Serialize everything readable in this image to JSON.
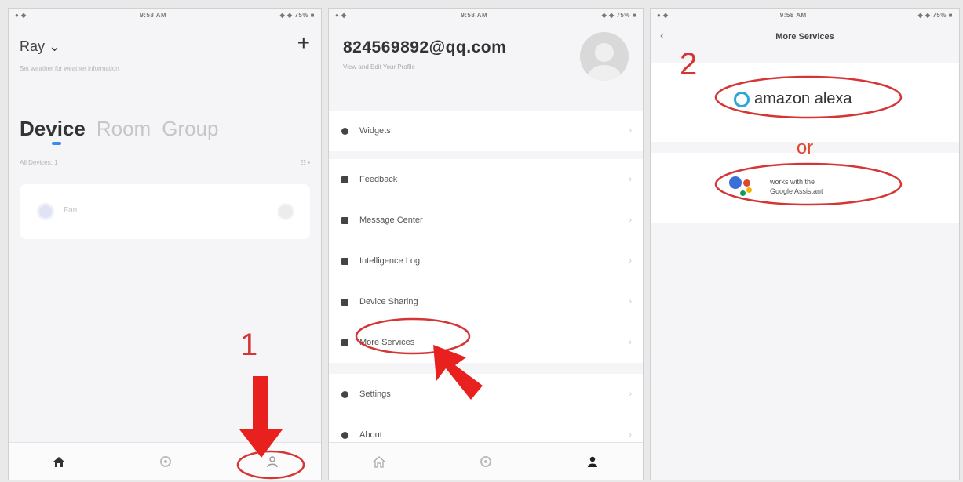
{
  "colors": {
    "annotation_red": "#d63535",
    "accent_blue": "#3c8ae8",
    "alexa_blue": "#2aa6d8"
  },
  "screen1": {
    "status": {
      "left": "● ◆",
      "time": "9:58 AM",
      "right": "◆ ◆ 75% ■"
    },
    "home_title": "Ray ⌄",
    "add_icon": "plus-icon",
    "subtitle": "Set weather for weather information",
    "tabs": [
      "Device",
      "Room",
      "Group"
    ],
    "device_count": "All Devices: 1",
    "device_name": "Fan",
    "nav_icons": [
      "home-icon",
      "scene-icon",
      "profile-icon"
    ]
  },
  "screen2": {
    "status": {
      "left": "● ◆",
      "time": "9:58 AM",
      "right": "◆ ◆ 75% ■"
    },
    "email": "824569892@qq.com",
    "profile_sub": "View and Edit Your Profile",
    "menu_1": [
      "Widgets"
    ],
    "menu_2": [
      "Feedback",
      "Message Center",
      "Intelligence Log",
      "Device Sharing",
      "More Services"
    ],
    "menu_3": [
      "Settings",
      "About"
    ],
    "chevron": "›"
  },
  "screen3": {
    "status": {
      "left": "● ◆",
      "time": "9:58 AM",
      "right": "◆ ◆ 75% ■"
    },
    "back_icon": "‹",
    "title": "More Services",
    "alexa_label": "amazon alexa",
    "or_label": "or",
    "ga_line1": "works with the",
    "ga_line2": "Google Assistant"
  },
  "annotations": {
    "step1": "1",
    "step2": "2"
  }
}
